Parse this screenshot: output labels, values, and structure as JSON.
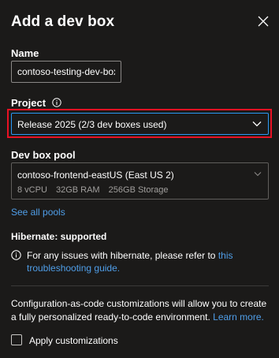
{
  "header": {
    "title": "Add a dev box",
    "close_icon": "close-icon"
  },
  "name_field": {
    "label": "Name",
    "value": "contoso-testing-dev-box"
  },
  "project_field": {
    "label": "Project",
    "info_icon": "info-icon",
    "selected": "Release 2025 (2/3 dev boxes used)",
    "highlight_color": "#e81123"
  },
  "pool_field": {
    "label": "Dev box pool",
    "selected_name": "contoso-frontend-eastUS (East US 2)",
    "specs": [
      "8 vCPU",
      "32GB RAM",
      "256GB Storage"
    ],
    "see_all": "See all pools"
  },
  "hibernate": {
    "title": "Hibernate: supported",
    "info_icon": "info-icon",
    "text": "For any issues with hibernate, please refer to",
    "link": "this troubleshooting guide."
  },
  "customization": {
    "text": "Configuration-as-code customizations will allow you to create a fully personalized ready-to-code environment.",
    "learn_more": "Learn more.",
    "checkbox_label": "Apply customizations",
    "checked": false
  },
  "colors": {
    "background": "#1b1a19",
    "accent": "#2899f5",
    "link": "#4f9ee8"
  }
}
